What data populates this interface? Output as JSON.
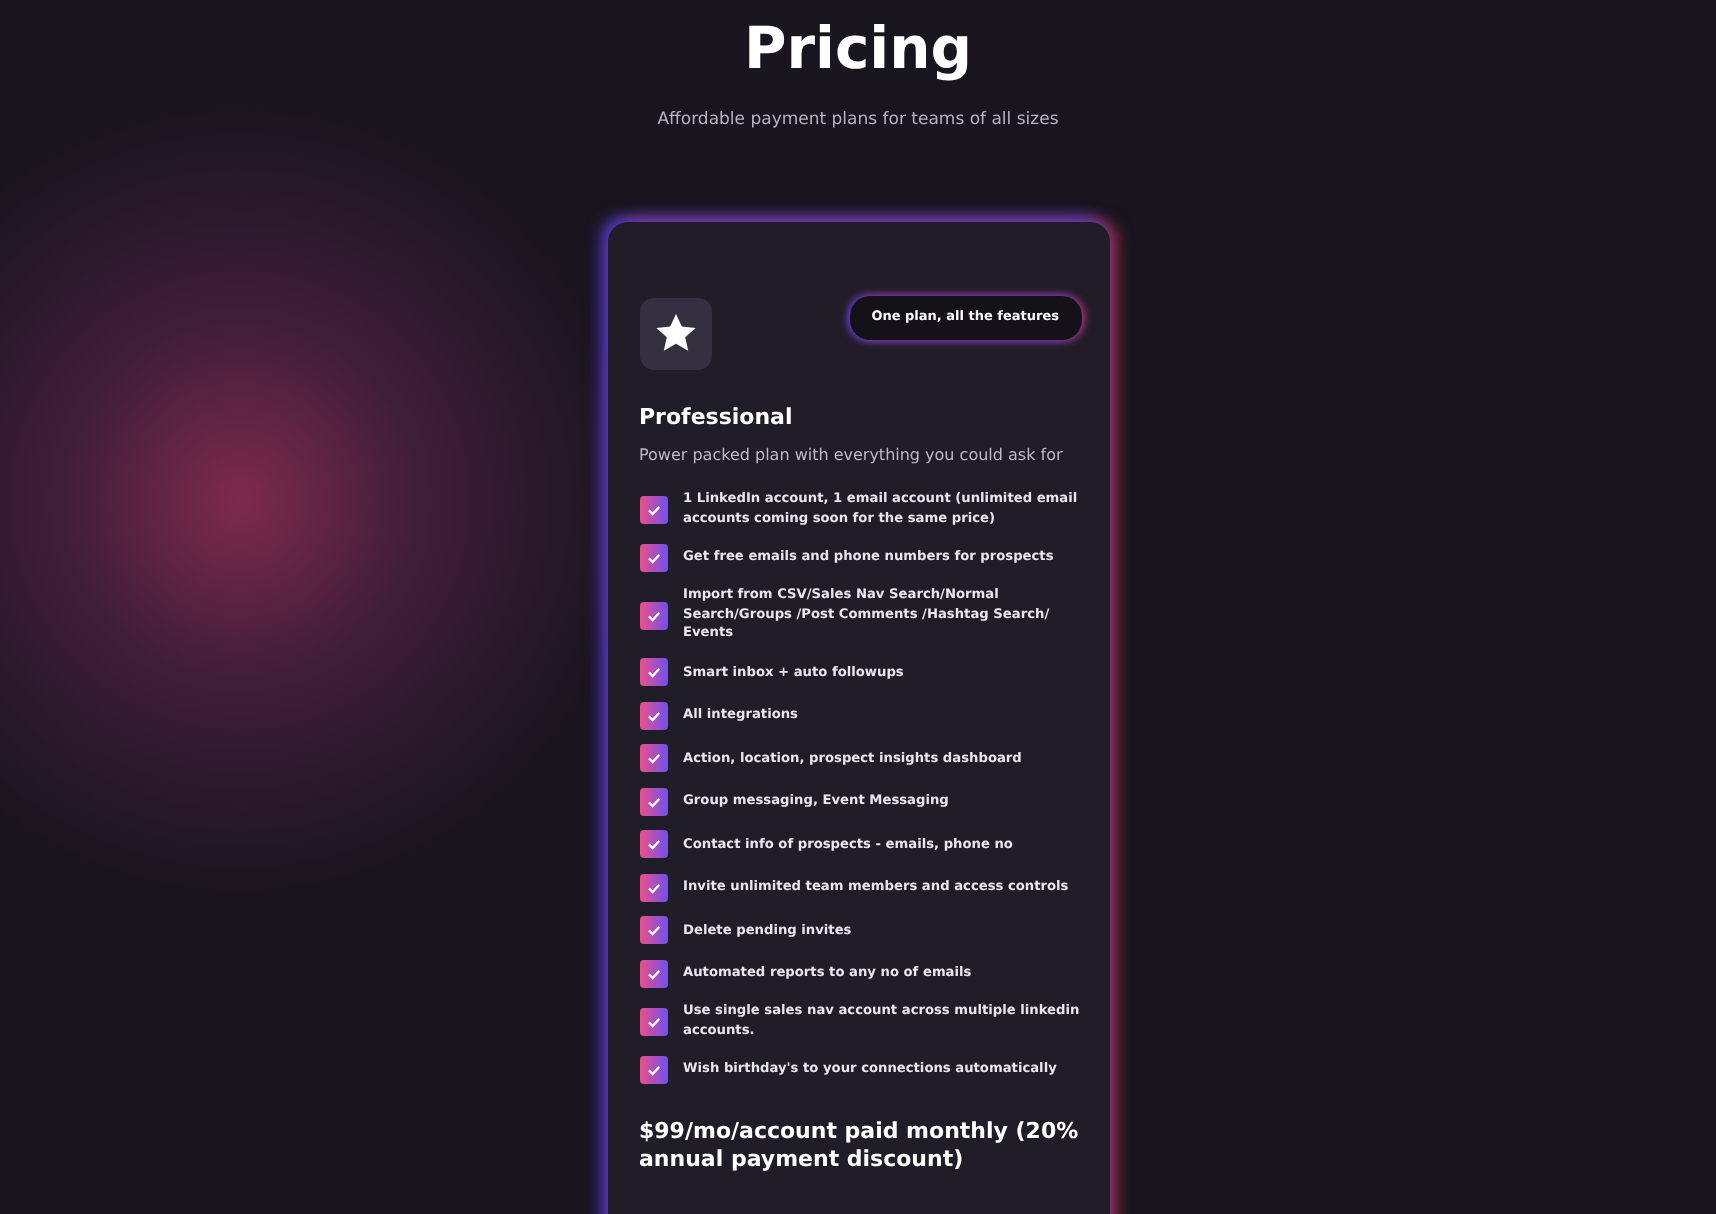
{
  "header": {
    "title": "Pricing",
    "subtitle": "Affordable payment plans for teams of all sizes"
  },
  "plan": {
    "badge": "One plan, all the features",
    "name": "Professional",
    "description": "Power packed plan with everything you could ask for",
    "features": [
      "1 LinkedIn account, 1 email account (unlimited email accounts coming soon for the same price)",
      "Get free emails and phone numbers for prospects",
      "Import from CSV/Sales Nav Search/Normal  Search/Groups /Post Comments /Hashtag Search/ Events",
      "Smart inbox + auto followups",
      "All integrations",
      "Action, location, prospect insights dashboard",
      "Group messaging, Event Messaging",
      "Contact info of prospects - emails, phone no",
      "Invite unlimited team members and access controls",
      "Delete pending invites",
      "Automated reports to any no of emails",
      "Use single sales nav account across multiple linkedin accounts.",
      "Wish birthday's to your connections automatically"
    ],
    "price": "$99/mo/account paid monthly (20% annual payment discount)"
  }
}
